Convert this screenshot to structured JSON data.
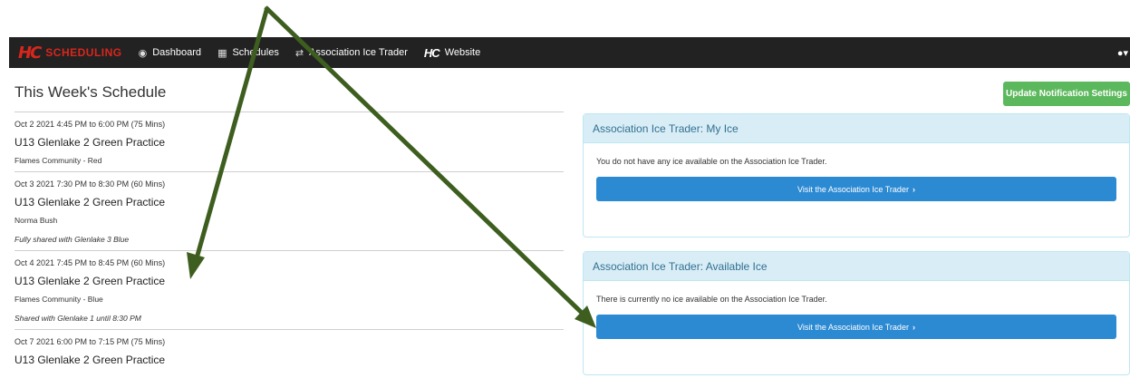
{
  "navbar": {
    "brand_logo": "HC",
    "brand_text": "SCHEDULING",
    "items": [
      {
        "icon": "dashboard-icon",
        "glyph": "◉",
        "label": "Dashboard"
      },
      {
        "icon": "calendar-icon",
        "glyph": "▦",
        "label": "Schedules"
      },
      {
        "icon": "exchange-icon",
        "glyph": "⇄",
        "label": "Association Ice Trader"
      },
      {
        "icon": "hc-logo-icon",
        "glyph": "HC",
        "label": "Website"
      }
    ],
    "user_icon": "user-icon"
  },
  "schedule": {
    "title": "This Week's Schedule",
    "items": [
      {
        "time": "Oct 2 2021 4:45 PM to 6:00 PM (75 Mins)",
        "title": "U13 Glenlake 2 Green Practice",
        "location": "Flames Community - Red",
        "note": ""
      },
      {
        "time": "Oct 3 2021 7:30 PM to 8:30 PM (60 Mins)",
        "title": "U13 Glenlake 2 Green Practice",
        "location": "Norma Bush",
        "note": "Fully shared with Glenlake 3 Blue"
      },
      {
        "time": "Oct 4 2021 7:45 PM to 8:45 PM (60 Mins)",
        "title": "U13 Glenlake 2 Green Practice",
        "location": "Flames Community - Blue",
        "note": "Shared with Glenlake 1 until 8:30 PM"
      },
      {
        "time": "Oct 7 2021 6:00 PM to 7:15 PM (75 Mins)",
        "title": "U13 Glenlake 2 Green Practice",
        "location": "",
        "note": ""
      }
    ]
  },
  "update_button": "Update Notification Settings",
  "panels": {
    "my_ice": {
      "title": "Association Ice Trader: My Ice",
      "message": "You do not have any ice available on the Association Ice Trader.",
      "button": "Visit the Association Ice Trader"
    },
    "available_ice": {
      "title": "Association Ice Trader: Available Ice",
      "message": "There is currently no ice available on the Association Ice Trader.",
      "button": "Visit the Association Ice Trader"
    }
  },
  "colors": {
    "navbar": "#222222",
    "brand": "#d9261c",
    "success": "#5cb85c",
    "primary": "#2c8ad3",
    "panel_head": "#d9edf7",
    "arrow": "#3d5e1f"
  }
}
